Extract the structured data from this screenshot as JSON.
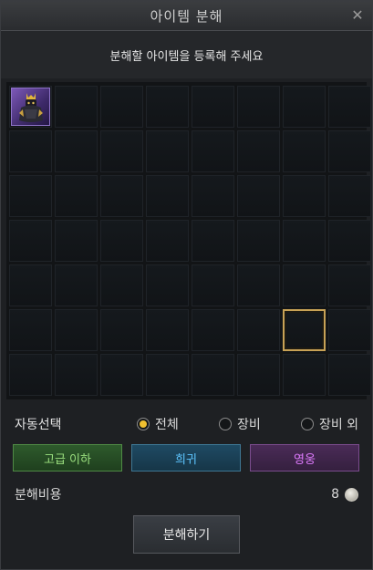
{
  "window": {
    "title": "아이템 분해",
    "close_icon": "close-icon"
  },
  "instruction": "분해할 아이템을 등록해 주세요",
  "grid": {
    "rows": 7,
    "cols": 8,
    "occupied_slot": {
      "row": 1,
      "col": 1,
      "item_icon": "armored-character-item-icon",
      "rarity_color": "#7c58b8"
    },
    "highlighted_slot": {
      "row": 6,
      "col": 7,
      "highlight_color": "#c8a256"
    }
  },
  "auto_select": {
    "label": "자동선택",
    "options": [
      {
        "label": "전체",
        "selected": true
      },
      {
        "label": "장비",
        "selected": false
      },
      {
        "label": "장비 외",
        "selected": false
      }
    ]
  },
  "grade_buttons": [
    {
      "label": "고급 이하",
      "color": "#9be07f"
    },
    {
      "label": "희귀",
      "color": "#5ec6ff"
    },
    {
      "label": "영웅",
      "color": "#e07bff"
    }
  ],
  "cost": {
    "label": "분해비용",
    "value": "8",
    "currency_icon": "silver-coin-icon"
  },
  "action": {
    "label": "분해하기"
  }
}
